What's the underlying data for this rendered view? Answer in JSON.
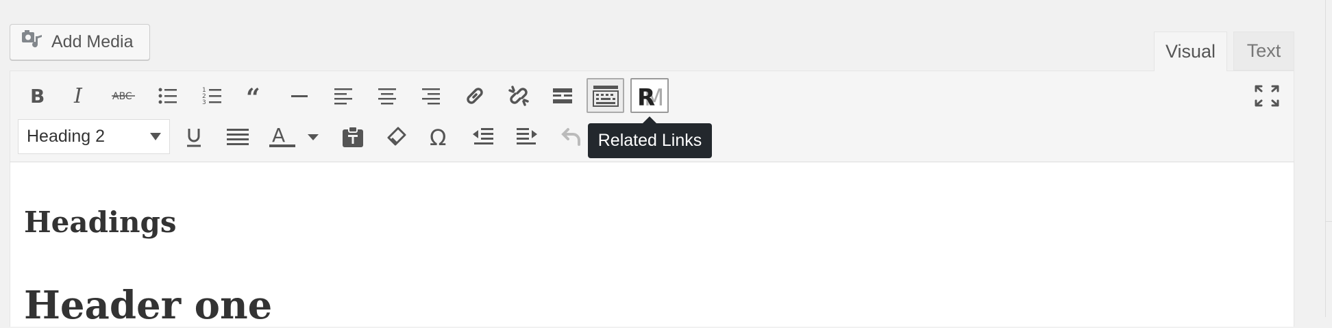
{
  "add_media": {
    "label": "Add Media",
    "icon": "media-camera-icon"
  },
  "tabs": [
    {
      "label": "Visual",
      "active": true
    },
    {
      "label": "Text",
      "active": false
    }
  ],
  "toolbar_row1": [
    {
      "name": "bold",
      "icon": "bold-icon"
    },
    {
      "name": "italic",
      "icon": "italic-icon"
    },
    {
      "name": "strikethrough",
      "icon": "strikethrough-icon"
    },
    {
      "name": "bullet-list",
      "icon": "bullet-list-icon"
    },
    {
      "name": "numbered-list",
      "icon": "numbered-list-icon"
    },
    {
      "name": "blockquote",
      "icon": "blockquote-icon"
    },
    {
      "name": "horizontal-line",
      "icon": "horizontal-line-icon"
    },
    {
      "name": "align-left",
      "icon": "align-left-icon"
    },
    {
      "name": "align-center",
      "icon": "align-center-icon"
    },
    {
      "name": "align-right",
      "icon": "align-right-icon"
    },
    {
      "name": "insert-link",
      "icon": "link-icon"
    },
    {
      "name": "remove-link",
      "icon": "unlink-icon"
    },
    {
      "name": "read-more",
      "icon": "read-more-icon"
    },
    {
      "name": "toolbar-toggle",
      "icon": "keyboard-icon"
    },
    {
      "name": "related-links",
      "icon": "related-links-logo-icon"
    }
  ],
  "format_select": {
    "value": "Heading 2"
  },
  "toolbar_row2": [
    {
      "name": "underline",
      "icon": "underline-icon"
    },
    {
      "name": "justify",
      "icon": "justify-icon"
    },
    {
      "name": "text-color",
      "icon": "text-color-icon"
    },
    {
      "name": "paste-as-text",
      "icon": "paste-text-icon"
    },
    {
      "name": "clear-formatting",
      "icon": "eraser-icon"
    },
    {
      "name": "special-character",
      "icon": "omega-icon"
    },
    {
      "name": "outdent",
      "icon": "outdent-icon"
    },
    {
      "name": "indent",
      "icon": "indent-icon"
    },
    {
      "name": "undo",
      "icon": "undo-icon"
    }
  ],
  "tooltip": {
    "text": "Related Links"
  },
  "content": {
    "heading_1": "Headings",
    "heading_2": "Header one"
  },
  "colors": {
    "page_bg": "#f1f1f1",
    "toolbar_bg": "#f5f5f5",
    "tooltip_bg": "#23282d",
    "icon": "#555555"
  }
}
